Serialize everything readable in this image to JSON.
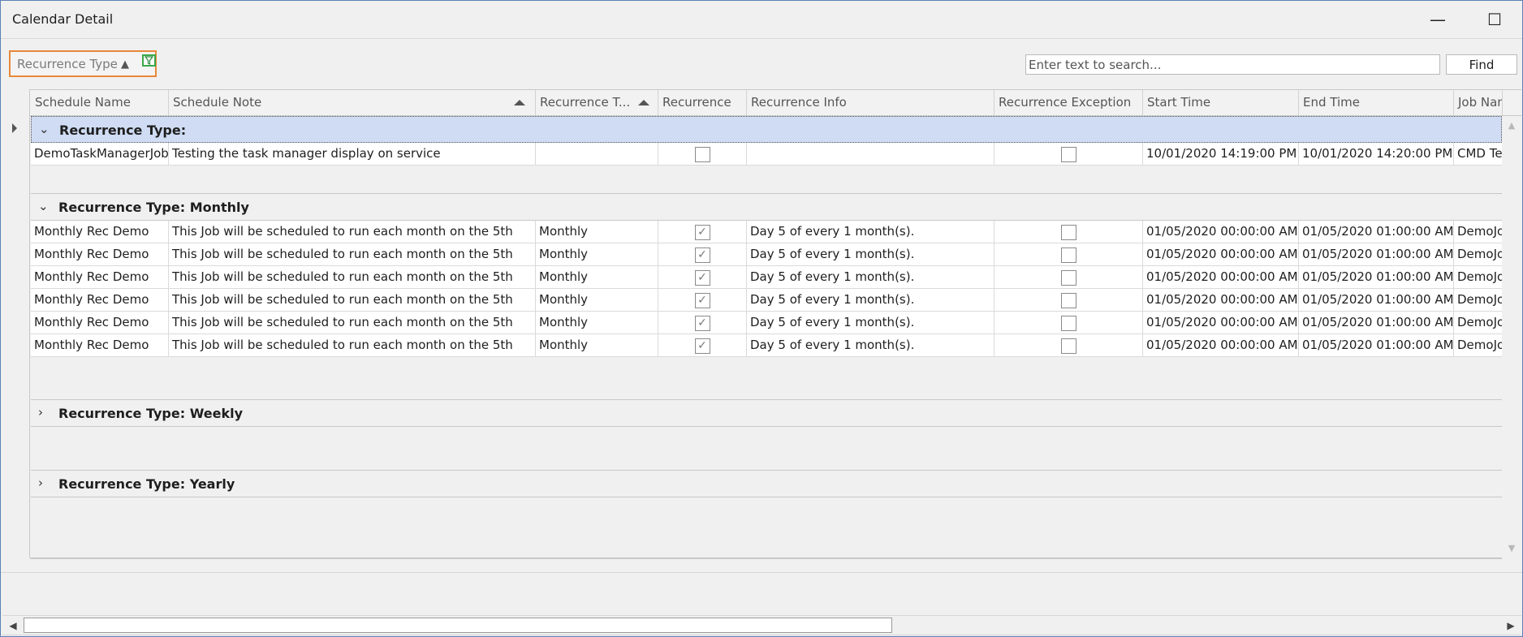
{
  "window": {
    "title": "Calendar Detail",
    "minimize_glyph": "—",
    "maximize_glyph": "☐",
    "close_glyph": "✕"
  },
  "group_panel": {
    "chip_label": "Recurrence Type",
    "sort_glyph": "▲",
    "filter_icon": "filter-icon",
    "accent_border": "#e8883a",
    "filter_border": "#3aa84a"
  },
  "search": {
    "placeholder": "Enter text to search...",
    "value": "",
    "find_label": "Find"
  },
  "columns": [
    {
      "label": "Schedule Name"
    },
    {
      "label": "Schedule Note"
    },
    {
      "label": "Recurrence T..."
    },
    {
      "label": "Recurrence"
    },
    {
      "label": "Recurrence Info"
    },
    {
      "label": "Recurrence Exception"
    },
    {
      "label": "Start Time"
    },
    {
      "label": "End Time"
    },
    {
      "label": "Job Name"
    }
  ],
  "groups": [
    {
      "title": "Recurrence Type:",
      "expanded": true,
      "selected": true,
      "rows": [
        {
          "schedule_name": "DemoTaskManagerJob",
          "schedule_note": "Testing the task manager display on service",
          "recurrence_type": "",
          "recurrence": false,
          "recurrence_info": "",
          "recurrence_exception": false,
          "start_time": "10/01/2020 14:19:00 PM",
          "end_time": "10/01/2020 14:20:00 PM",
          "job_name": "CMD Te"
        }
      ]
    },
    {
      "title": "Recurrence Type: Monthly",
      "expanded": true,
      "selected": false,
      "rows": [
        {
          "schedule_name": "Monthly Rec Demo",
          "schedule_note": "This Job will be scheduled to run each month on the 5th",
          "recurrence_type": "Monthly",
          "recurrence": true,
          "recurrence_info": "Day 5 of every 1 month(s).",
          "recurrence_exception": false,
          "start_time": "01/05/2020 00:00:00 AM",
          "end_time": "01/05/2020 01:00:00 AM",
          "job_name": "DemoJo"
        },
        {
          "schedule_name": "Monthly Rec Demo",
          "schedule_note": "This Job will be scheduled to run each month on the 5th",
          "recurrence_type": "Monthly",
          "recurrence": true,
          "recurrence_info": "Day 5 of every 1 month(s).",
          "recurrence_exception": false,
          "start_time": "01/05/2020 00:00:00 AM",
          "end_time": "01/05/2020 01:00:00 AM",
          "job_name": "DemoJo"
        },
        {
          "schedule_name": "Monthly Rec Demo",
          "schedule_note": "This Job will be scheduled to run each month on the 5th",
          "recurrence_type": "Monthly",
          "recurrence": true,
          "recurrence_info": "Day 5 of every 1 month(s).",
          "recurrence_exception": false,
          "start_time": "01/05/2020 00:00:00 AM",
          "end_time": "01/05/2020 01:00:00 AM",
          "job_name": "DemoJo"
        },
        {
          "schedule_name": "Monthly Rec Demo",
          "schedule_note": "This Job will be scheduled to run each month on the 5th",
          "recurrence_type": "Monthly",
          "recurrence": true,
          "recurrence_info": "Day 5 of every 1 month(s).",
          "recurrence_exception": false,
          "start_time": "01/05/2020 00:00:00 AM",
          "end_time": "01/05/2020 01:00:00 AM",
          "job_name": "DemoJo"
        },
        {
          "schedule_name": "Monthly Rec Demo",
          "schedule_note": "This Job will be scheduled to run each month on the 5th",
          "recurrence_type": "Monthly",
          "recurrence": true,
          "recurrence_info": "Day 5 of every 1 month(s).",
          "recurrence_exception": false,
          "start_time": "01/05/2020 00:00:00 AM",
          "end_time": "01/05/2020 01:00:00 AM",
          "job_name": "DemoJo"
        },
        {
          "schedule_name": "Monthly Rec Demo",
          "schedule_note": "This Job will be scheduled to run each month on the 5th",
          "recurrence_type": "Monthly",
          "recurrence": true,
          "recurrence_info": "Day 5 of every 1 month(s).",
          "recurrence_exception": false,
          "start_time": "01/05/2020 00:00:00 AM",
          "end_time": "01/05/2020 01:00:00 AM",
          "job_name": "DemoJo"
        }
      ]
    },
    {
      "title": "Recurrence Type: Weekly",
      "expanded": false,
      "selected": false,
      "rows": []
    },
    {
      "title": "Recurrence Type: Yearly",
      "expanded": false,
      "selected": false,
      "rows": []
    }
  ],
  "icons": {
    "expanded": "chevron-down-icon",
    "collapsed": "chevron-right-icon",
    "check": "✓"
  },
  "colors": {
    "selected_group_bg": "#cfdcf3",
    "window_border": "#5b7fb5"
  }
}
